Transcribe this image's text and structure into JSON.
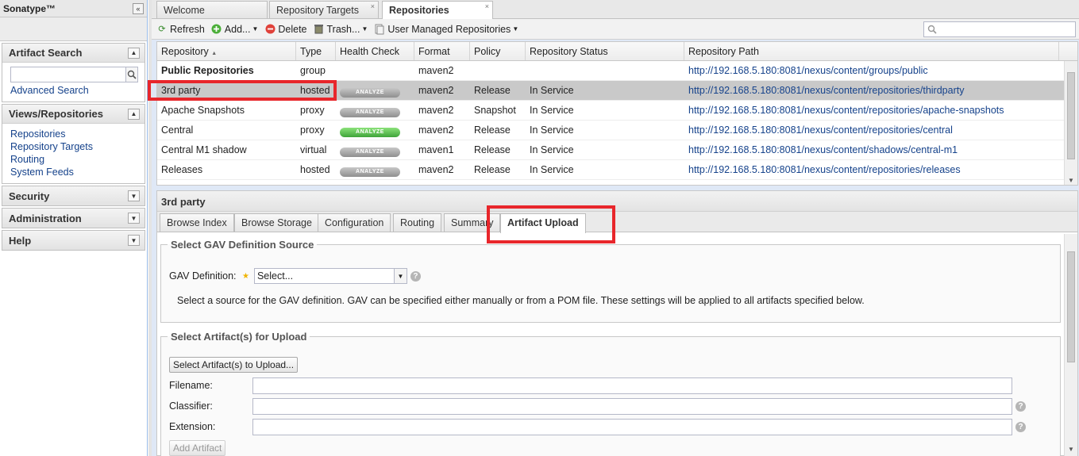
{
  "sidebar": {
    "brand": "Sonatype™",
    "collapse_icon": "«",
    "artifact_search": {
      "title": "Artifact Search",
      "advanced": "Advanced Search"
    },
    "views": {
      "title": "Views/Repositories",
      "items": [
        "Repositories",
        "Repository Targets",
        "Routing",
        "System Feeds"
      ]
    },
    "security": "Security",
    "administration": "Administration",
    "help": "Help"
  },
  "tabs": [
    {
      "label": "Welcome"
    },
    {
      "label": "Repository Targets"
    },
    {
      "label": "Repositories"
    }
  ],
  "tab_close": "×",
  "toolbar": {
    "refresh": "Refresh",
    "add": "Add...",
    "delete": "Delete",
    "trash": "Trash...",
    "user_managed": "User Managed Repositories"
  },
  "grid": {
    "headers": [
      "Repository",
      "Type",
      "Health Check",
      "Format",
      "Policy",
      "Repository Status",
      "Repository Path"
    ],
    "sort_indicator": "▲",
    "analyze_label": "ANALYZE",
    "rows": [
      {
        "name": "Public Repositories",
        "type": "group",
        "format": "maven2",
        "policy": "",
        "status": "",
        "path": "http://192.168.5.180:8081/nexus/content/groups/public"
      },
      {
        "name": "3rd party",
        "type": "hosted",
        "format": "maven2",
        "policy": "Release",
        "status": "In Service",
        "path": "http://192.168.5.180:8081/nexus/content/repositories/thirdparty"
      },
      {
        "name": "Apache Snapshots",
        "type": "proxy",
        "format": "maven2",
        "policy": "Snapshot",
        "status": "In Service",
        "path": "http://192.168.5.180:8081/nexus/content/repositories/apache-snapshots"
      },
      {
        "name": "Central",
        "type": "proxy",
        "format": "maven2",
        "policy": "Release",
        "status": "In Service",
        "path": "http://192.168.5.180:8081/nexus/content/repositories/central"
      },
      {
        "name": "Central M1 shadow",
        "type": "virtual",
        "format": "maven1",
        "policy": "Release",
        "status": "In Service",
        "path": "http://192.168.5.180:8081/nexus/content/shadows/central-m1"
      },
      {
        "name": "Releases",
        "type": "hosted",
        "format": "maven2",
        "policy": "Release",
        "status": "In Service",
        "path": "http://192.168.5.180:8081/nexus/content/repositories/releases"
      }
    ]
  },
  "detail": {
    "title": "3rd party",
    "tabs": [
      "Browse Index",
      "Browse Storage",
      "Configuration",
      "Routing",
      "Summary",
      "Artifact Upload"
    ],
    "gav_section": {
      "legend": "Select GAV Definition Source",
      "label": "GAV Definition:",
      "required_mark": "★",
      "select_value": "Select...",
      "help_glyph": "?",
      "info": "Select a source for the GAV definition. GAV can be specified either manually or from a POM file. These settings will be applied to all artifacts specified below."
    },
    "upload_section": {
      "legend": "Select Artifact(s) for Upload",
      "select_button": "Select Artifact(s) to Upload...",
      "filename_label": "Filename:",
      "classifier_label": "Classifier:",
      "extension_label": "Extension:",
      "add_button": "Add Artifact"
    }
  }
}
